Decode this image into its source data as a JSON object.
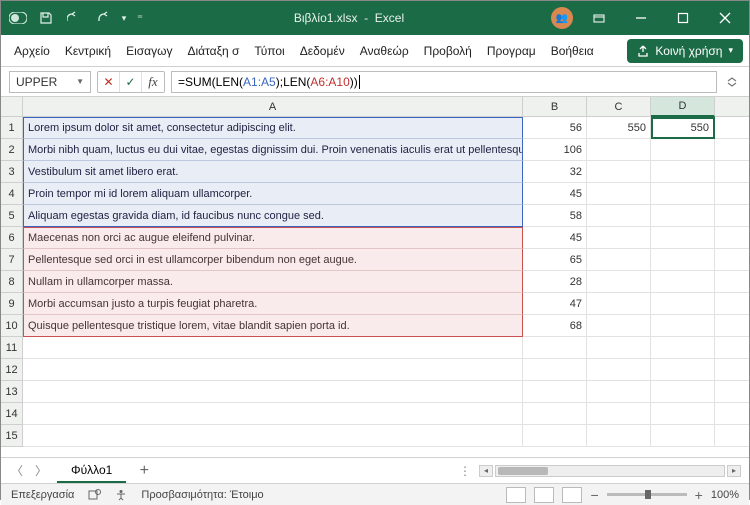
{
  "titlebar": {
    "filename": "Βιβλίο1.xlsx",
    "appname": "Excel"
  },
  "ribbon": {
    "tabs": [
      "Αρχείο",
      "Κεντρική",
      "Εισαγωγ",
      "Διάταξη σ",
      "Τύποι",
      "Δεδομέν",
      "Αναθεώρ",
      "Προβολή",
      "Προγραμ",
      "Βοήθεια"
    ],
    "share": "Κοινή χρήση"
  },
  "formula": {
    "namebox": "UPPER",
    "plain": "=SUM(",
    "fn1": "LEN",
    "open": "(",
    "arg1": "A1:A5",
    "close_semi": "); ",
    "arg2": "A6:A10",
    "close2": "))"
  },
  "columns": [
    "A",
    "B",
    "C",
    "D"
  ],
  "rows": [
    {
      "n": "1",
      "a": "Lorem ipsum dolor sit amet, consectetur adipiscing elit.",
      "b": "56",
      "c": "550",
      "d": "550",
      "range": "blue",
      "pos": "top",
      "active_d": true
    },
    {
      "n": "2",
      "a": "Morbi nibh quam, luctus eu dui vitae, egestas dignissim dui. Proin venenatis iaculis erat ut pellentesque.",
      "b": "106",
      "c": "",
      "d": "",
      "range": "blue",
      "pos": "mid"
    },
    {
      "n": "3",
      "a": "Vestibulum sit amet libero erat.",
      "b": "32",
      "c": "",
      "d": "",
      "range": "blue",
      "pos": "mid"
    },
    {
      "n": "4",
      "a": "Proin tempor mi id lorem aliquam ullamcorper.",
      "b": "45",
      "c": "",
      "d": "",
      "range": "blue",
      "pos": "mid"
    },
    {
      "n": "5",
      "a": "Aliquam egestas gravida diam, id faucibus nunc congue sed.",
      "b": "58",
      "c": "",
      "d": "",
      "range": "blue",
      "pos": "bot"
    },
    {
      "n": "6",
      "a": "Maecenas non orci ac augue eleifend pulvinar.",
      "b": "45",
      "c": "",
      "d": "",
      "range": "red",
      "pos": "top"
    },
    {
      "n": "7",
      "a": "Pellentesque sed orci in est ullamcorper bibendum non eget augue.",
      "b": "65",
      "c": "",
      "d": "",
      "range": "red",
      "pos": "mid"
    },
    {
      "n": "8",
      "a": "Nullam in ullamcorper massa.",
      "b": "28",
      "c": "",
      "d": "",
      "range": "red",
      "pos": "mid"
    },
    {
      "n": "9",
      "a": "Morbi accumsan justo a turpis feugiat pharetra.",
      "b": "47",
      "c": "",
      "d": "",
      "range": "red",
      "pos": "mid"
    },
    {
      "n": "10",
      "a": "Quisque pellentesque tristique lorem, vitae blandit sapien porta id.",
      "b": "68",
      "c": "",
      "d": "",
      "range": "red",
      "pos": "bot"
    },
    {
      "n": "11",
      "a": "",
      "b": "",
      "c": "",
      "d": ""
    },
    {
      "n": "12",
      "a": "",
      "b": "",
      "c": "",
      "d": ""
    },
    {
      "n": "13",
      "a": "",
      "b": "",
      "c": "",
      "d": ""
    },
    {
      "n": "14",
      "a": "",
      "b": "",
      "c": "",
      "d": ""
    },
    {
      "n": "15",
      "a": "",
      "b": "",
      "c": "",
      "d": ""
    }
  ],
  "sheettab": "Φύλλο1",
  "status": {
    "mode": "Επεξεργασία",
    "access": "Προσβασιμότητα: Έτοιμο",
    "zoom": "100%"
  }
}
